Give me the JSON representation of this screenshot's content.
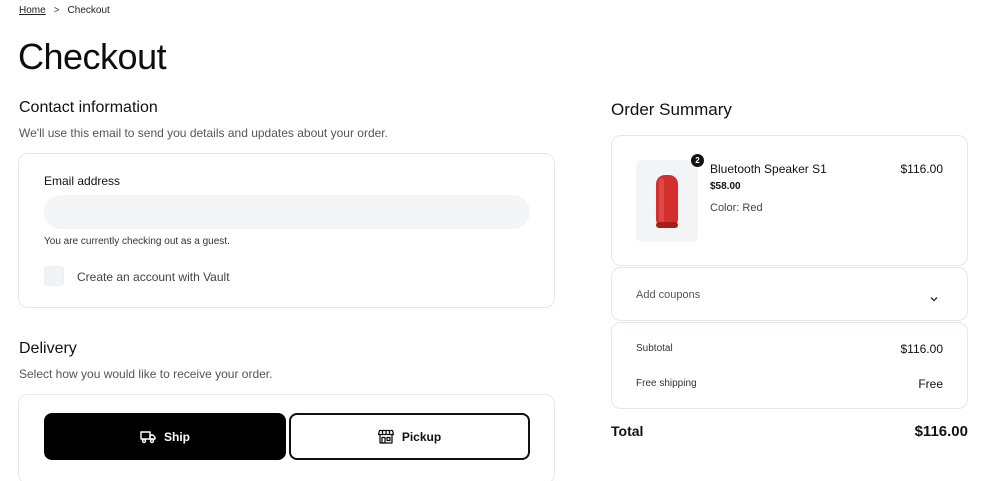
{
  "breadcrumb": {
    "home": "Home",
    "separator": ">",
    "current": "Checkout"
  },
  "page": {
    "title": "Checkout"
  },
  "contact": {
    "title": "Contact information",
    "subtitle": "We'll use this email to send you details and updates about your order.",
    "email_label": "Email address",
    "email_value": "",
    "email_placeholder": "",
    "guest_note": "You are currently checking out as a guest.",
    "create_account_label": "Create an account with Vault",
    "create_account_checked": false
  },
  "delivery": {
    "title": "Delivery",
    "subtitle": "Select how you would like to receive your order.",
    "options": [
      {
        "label": "Ship",
        "icon": "truck-icon",
        "selected": true
      },
      {
        "label": "Pickup",
        "icon": "store-icon",
        "selected": false
      }
    ]
  },
  "summary": {
    "title": "Order Summary",
    "item": {
      "name": "Bluetooth Speaker S1",
      "unit_price": "$58.00",
      "color": "Color: Red",
      "quantity": "2",
      "line_total": "$116.00",
      "product_color_hex": "#d32f2f"
    },
    "coupon_label": "Add coupons",
    "subtotal_label": "Subtotal",
    "subtotal_value": "$116.00",
    "shipping_label": "Free shipping",
    "shipping_value": "Free",
    "total_label": "Total",
    "total_value": "$116.00"
  },
  "colors": {
    "primary": "#000000",
    "border": "#e6e7eb",
    "input_bg": "#f4f5f7"
  }
}
